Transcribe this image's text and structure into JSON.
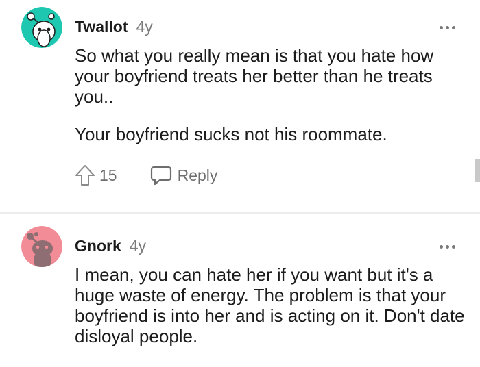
{
  "comments": [
    {
      "username": "Twallot",
      "age": "4y",
      "paragraphs": [
        "So what you really mean is that you hate how your boyfriend treats her better than he treats you..",
        "Your boyfriend sucks not his roommate."
      ],
      "votes": "15",
      "reply_label": "Reply",
      "avatar_color": "#1ec8b0"
    },
    {
      "username": "Gnork",
      "age": "4y",
      "paragraphs": [
        "I mean, you can hate her if you want but it's a huge waste of energy. The problem is that your boyfriend is into her and is acting on it. Don't date disloyal people."
      ],
      "avatar_color": "#f28c96"
    }
  ],
  "icons": {
    "upvote": "upvote-arrow-icon",
    "reply": "speech-bubble-icon",
    "more": "more-options-icon"
  }
}
